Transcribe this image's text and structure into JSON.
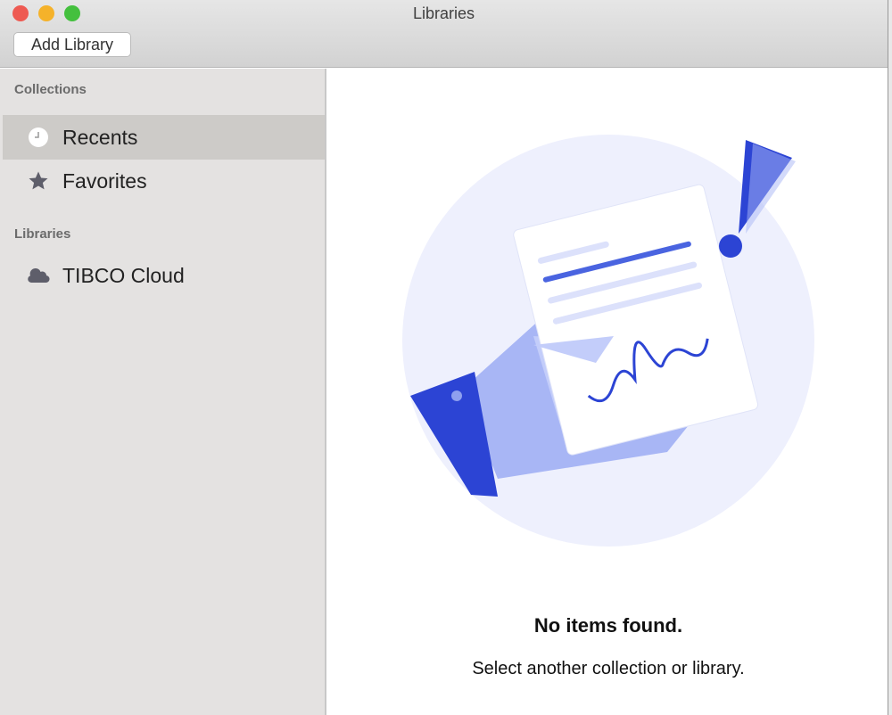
{
  "window": {
    "title": "Libraries"
  },
  "toolbar": {
    "add_library_label": "Add Library"
  },
  "sidebar": {
    "collections_header": "Collections",
    "collections": [
      {
        "label": "Recents",
        "icon": "clock-icon",
        "selected": true
      },
      {
        "label": "Favorites",
        "icon": "star-icon"
      }
    ],
    "libraries_header": "Libraries",
    "libraries": [
      {
        "label": "TIBCO Cloud",
        "icon": "cloud-icon"
      }
    ]
  },
  "main": {
    "empty_title": "No items found.",
    "empty_subtitle": "Select another collection or library."
  },
  "colors": {
    "accent": "#2c44d4",
    "illustration_bg": "#eef0fd"
  }
}
